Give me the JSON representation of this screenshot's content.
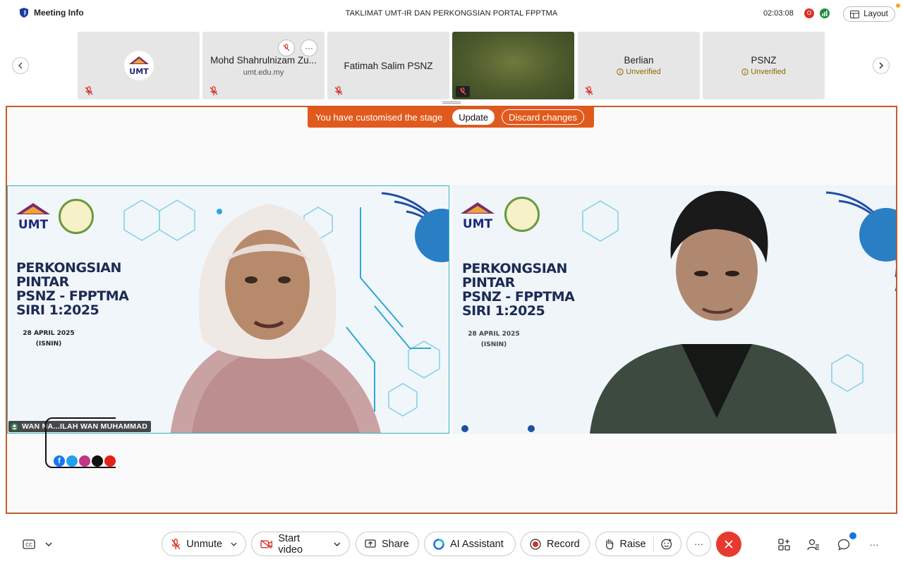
{
  "header": {
    "meeting_info_label": "Meeting Info",
    "meeting_title": "TAKLIMAT UMT-IR DAN PERKONGSIAN PORTAL FPPTMA",
    "timer": "02:03:08",
    "recording_badge": "O",
    "layout_label": "Layout"
  },
  "participants": [
    {
      "name": "",
      "subtitle": "",
      "muted": true,
      "avatar": "UMT"
    },
    {
      "name": "Mohd Shahrulnizam Zu...",
      "subtitle": "umt.edu.my",
      "muted": true
    },
    {
      "name": "Fatimah Salim PSNZ",
      "subtitle": "",
      "muted": true
    },
    {
      "name": "",
      "subtitle": "",
      "muted": true,
      "video": true
    },
    {
      "name": "Berlian",
      "subtitle": "Unverified",
      "muted": true
    },
    {
      "name": "PSNZ",
      "subtitle": "Unverified",
      "muted": false
    }
  ],
  "stage_banner": {
    "text": "You have customised the stage",
    "update_label": "Update",
    "discard_label": "Discard changes"
  },
  "stage": {
    "left_video": {
      "slide_title_lines": [
        "PERKONGSIAN",
        "PINTAR",
        "PSNZ - FPPTMA",
        "SIRI 1:2025"
      ],
      "slide_date": "28 APRIL 2025",
      "slide_day": "(ISNIN)",
      "logo_text": "UMT",
      "name_tag": "WAN NA...ILAH WAN MUHAMMAD"
    },
    "right_video": {
      "slide_title_lines": [
        "PERKONGSIAN",
        "PINTAR",
        "PSNZ - FPPTMA",
        "SIRI 1:2025"
      ],
      "slide_date": "28 APRIL 2025",
      "slide_day": "(ISNIN)",
      "logo_text": "UMT"
    }
  },
  "toolbar": {
    "unmute_label": "Unmute",
    "start_video_label": "Start video",
    "share_label": "Share",
    "ai_assistant_label": "AI Assistant",
    "record_label": "Record",
    "raise_label": "Raise",
    "more_label": "···"
  },
  "colors": {
    "stage_border": "#c55a2b",
    "banner_bg": "#e05a1e",
    "end_call": "#e8392f",
    "active_speaker": "#2fb8c9"
  }
}
